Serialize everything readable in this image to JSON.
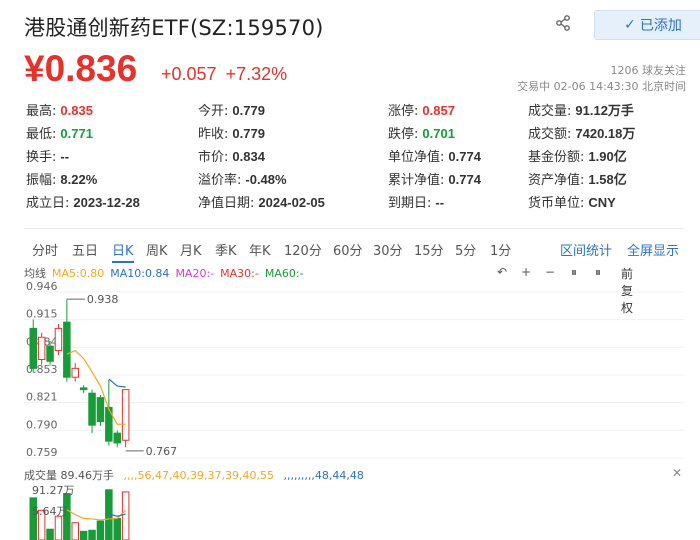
{
  "header": {
    "title": "港股通创新药ETF(SZ:159570)",
    "follow_label": "已添加",
    "follow_check": "✓",
    "share_icon": "share-icon"
  },
  "price": {
    "current": "¥0.836",
    "change": "+0.057",
    "change_pct": "+7.32%",
    "followers": "1206 球友关注",
    "status": "交易中 02-06 14:43:30 北京时间"
  },
  "quote": [
    [
      {
        "label": "最高:",
        "value": "0.835",
        "color": "red"
      },
      {
        "label": "今开:",
        "value": "0.779",
        "color": "normal"
      },
      {
        "label": "涨停:",
        "value": "0.857",
        "color": "red"
      },
      {
        "label": "成交量:",
        "value": "91.12万手",
        "color": "normal"
      }
    ],
    [
      {
        "label": "最低:",
        "value": "0.771",
        "color": "green"
      },
      {
        "label": "昨收:",
        "value": "0.779",
        "color": "normal"
      },
      {
        "label": "跌停:",
        "value": "0.701",
        "color": "green"
      },
      {
        "label": "成交额:",
        "value": "7420.18万",
        "color": "normal"
      }
    ],
    [
      {
        "label": "换手:",
        "value": "--",
        "color": "normal"
      },
      {
        "label": "市价:",
        "value": "0.834",
        "color": "normal"
      },
      {
        "label": "单位净值:",
        "value": "0.774",
        "color": "normal"
      },
      {
        "label": "基金份额:",
        "value": "1.90亿",
        "color": "normal"
      }
    ],
    [
      {
        "label": "振幅:",
        "value": "8.22%",
        "color": "normal"
      },
      {
        "label": "溢价率:",
        "value": "-0.48%",
        "color": "normal"
      },
      {
        "label": "累计净值:",
        "value": "0.774",
        "color": "normal"
      },
      {
        "label": "资产净值:",
        "value": "1.58亿",
        "color": "normal"
      }
    ],
    [
      {
        "label": "成立日:",
        "value": "2023-12-28",
        "color": "normal"
      },
      {
        "label": "净值日期:",
        "value": "2024-02-05",
        "color": "normal"
      },
      {
        "label": "到期日:",
        "value": "--",
        "color": "normal"
      },
      {
        "label": "货币单位:",
        "value": "CNY",
        "color": "normal"
      }
    ]
  ],
  "tabs": [
    "分时",
    "五日",
    "日K",
    "周K",
    "月K",
    "季K",
    "年K",
    "120分",
    "60分",
    "30分",
    "15分",
    "5分",
    "1分"
  ],
  "active_tab": "日K",
  "tab_links": [
    "区间统计",
    "全屏显示"
  ],
  "ma": {
    "label": "均线",
    "items": [
      {
        "text": "MA5:0.80",
        "color": "#f5a623"
      },
      {
        "text": "MA10:0.84",
        "color": "#2d72c4"
      },
      {
        "text": "MA20:-",
        "color": "#d63ad6"
      },
      {
        "text": "MA30:-",
        "color": "#e5322d"
      },
      {
        "text": "MA60:-",
        "color": "#1a9b3a"
      }
    ],
    "tools": [
      "↶",
      "+",
      "−",
      "⏸",
      "⏸"
    ],
    "adjust": "前复权"
  },
  "colors": {
    "up": "#e5322d",
    "down": "#1a9b3a",
    "accent": "#2d72c4",
    "ma5": "#f5a623",
    "ma10": "#2d72c4"
  },
  "chart_data": {
    "type": "candlestick",
    "y_ticks": [
      "0.946",
      "0.915",
      "0.884",
      "0.853",
      "0.821",
      "0.790",
      "0.759"
    ],
    "ylim": [
      0.759,
      0.946
    ],
    "high_marker": "0.938",
    "low_marker": "0.767",
    "candles": [
      {
        "o": 0.905,
        "c": 0.86,
        "h": 0.915,
        "l": 0.855
      },
      {
        "o": 0.87,
        "c": 0.895,
        "h": 0.9,
        "l": 0.864
      },
      {
        "o": 0.885,
        "c": 0.868,
        "h": 0.891,
        "l": 0.863
      },
      {
        "o": 0.88,
        "c": 0.905,
        "h": 0.91,
        "l": 0.875
      },
      {
        "o": 0.912,
        "c": 0.85,
        "h": 0.938,
        "l": 0.845
      },
      {
        "o": 0.85,
        "c": 0.86,
        "h": 0.866,
        "l": 0.845
      },
      {
        "o": 0.838,
        "c": 0.836,
        "h": 0.841,
        "l": 0.832
      },
      {
        "o": 0.832,
        "c": 0.796,
        "h": 0.836,
        "l": 0.787
      },
      {
        "o": 0.827,
        "c": 0.8,
        "h": 0.83,
        "l": 0.795
      },
      {
        "o": 0.816,
        "c": 0.778,
        "h": 0.847,
        "l": 0.773
      },
      {
        "o": 0.787,
        "c": 0.776,
        "h": 0.79,
        "l": 0.771
      },
      {
        "o": 0.779,
        "c": 0.836,
        "h": 0.835,
        "l": 0.771
      }
    ],
    "ma5": [
      null,
      null,
      null,
      null,
      0.876,
      0.88,
      0.871,
      0.856,
      0.84,
      0.814,
      0.797,
      0.797
    ],
    "ma10": [
      null,
      null,
      null,
      null,
      null,
      null,
      null,
      null,
      null,
      0.848,
      0.84,
      0.839
    ]
  },
  "volume": {
    "header": "成交量 89.46万手",
    "ma5": [
      null,
      null,
      null,
      null,
      56,
      47,
      40,
      39,
      37,
      39,
      40,
      55
    ],
    "ma10": [
      null,
      null,
      null,
      null,
      null,
      null,
      null,
      null,
      null,
      48,
      44,
      48
    ],
    "tick_top": "91.27万",
    "tick_mid": "5.64万",
    "close": "✕",
    "values": [
      78,
      55,
      20,
      44,
      86,
      32,
      16,
      18,
      35,
      93,
      40,
      89
    ],
    "max": 100
  }
}
